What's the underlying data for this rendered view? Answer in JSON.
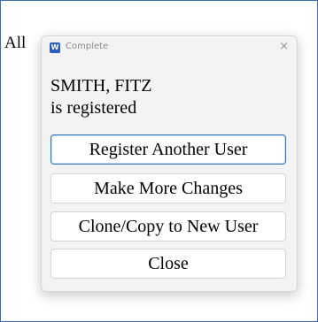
{
  "background": {
    "partial_text": "All"
  },
  "dialog": {
    "title": "Complete",
    "app_icon_letter": "W",
    "close_glyph": "×",
    "message_line1": "SMITH, FITZ",
    "message_line2": "is registered",
    "buttons": {
      "register_another": "Register Another User",
      "make_more_changes": "Make More Changes",
      "clone_copy": "Clone/Copy to New User",
      "close": "Close"
    }
  }
}
